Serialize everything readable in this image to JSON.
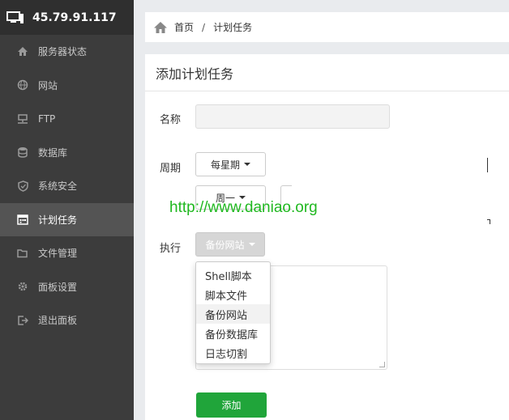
{
  "sidebar": {
    "server_ip": "45.79.91.117",
    "items": [
      {
        "label": "服务器状态",
        "icon": "home-icon"
      },
      {
        "label": "网站",
        "icon": "globe-icon"
      },
      {
        "label": "FTP",
        "icon": "ftp-icon"
      },
      {
        "label": "数据库",
        "icon": "database-icon"
      },
      {
        "label": "系统安全",
        "icon": "shield-icon"
      },
      {
        "label": "计划任务",
        "icon": "calendar-icon",
        "active": true
      },
      {
        "label": "文件管理",
        "icon": "folder-icon"
      },
      {
        "label": "面板设置",
        "icon": "gear-icon"
      },
      {
        "label": "退出面板",
        "icon": "logout-icon"
      }
    ]
  },
  "breadcrumb": {
    "home": "首页",
    "separator": "/",
    "current": "计划任务"
  },
  "form": {
    "title": "添加计划任务",
    "name_label": "名称",
    "name_value": "",
    "period_label": "周期",
    "period_value": "每星期",
    "weekday_value": "周一",
    "exec_label": "执行",
    "exec_value": "备份网站",
    "exec_options": [
      "Shell脚本",
      "脚本文件",
      "备份网站",
      "备份数据库",
      "日志切割"
    ],
    "submit_label": "添加"
  },
  "watermark": "http://www.daniao.org",
  "colors": {
    "accent": "#20a53a",
    "sidebar_bg": "#3c3c3c",
    "sidebar_active": "#545454"
  }
}
